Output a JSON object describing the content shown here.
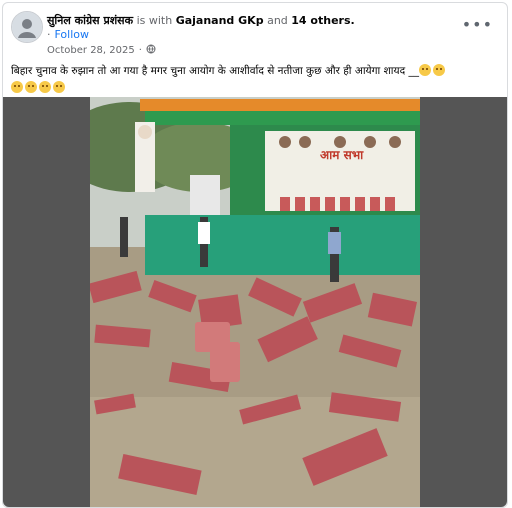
{
  "post": {
    "author": "सुनिल कांग्रेस प्रशंसक",
    "with_text": "is with",
    "with_name": "Gajanand GKp",
    "and_text": "and",
    "others": "14 others.",
    "follow": "Follow",
    "date": "October 28, 2025",
    "separator": "·",
    "body": "बिहार चुनाव के रुझान तो आ गया है मगर चुना आयोग के आशीर्वाद से नतीजा कुछ और ही आयेगा शायद __",
    "more_icon": "more-options-icon",
    "privacy_icon": "globe-icon"
  },
  "photo": {
    "banner_text": "आम सभा"
  }
}
